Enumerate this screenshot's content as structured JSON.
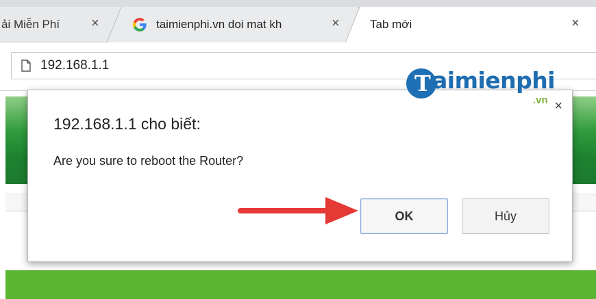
{
  "tabs": [
    {
      "label": "ải Miễn Phí",
      "close": "×"
    },
    {
      "label": "taimienphi.vn doi mat kh",
      "close": "×",
      "icon": "google-g-icon"
    },
    {
      "label": "Tab mới",
      "close": "×"
    }
  ],
  "address_bar": {
    "url": "192.168.1.1",
    "icon": "page-icon"
  },
  "watermark": {
    "brand": "aimienphi",
    "domain": ".vn",
    "logo_letter": "T"
  },
  "dialog": {
    "title": "192.168.1.1 cho biết:",
    "message": "Are you sure to reboot the Router?",
    "close": "×",
    "ok_label": "OK",
    "cancel_label": "Hủy"
  },
  "colors": {
    "arrow": "#e53935",
    "banner_green": "#1d8230",
    "bottom_bar": "#5cb531",
    "watermark_blue": "#1d6db0",
    "watermark_green": "#7fb23a"
  }
}
